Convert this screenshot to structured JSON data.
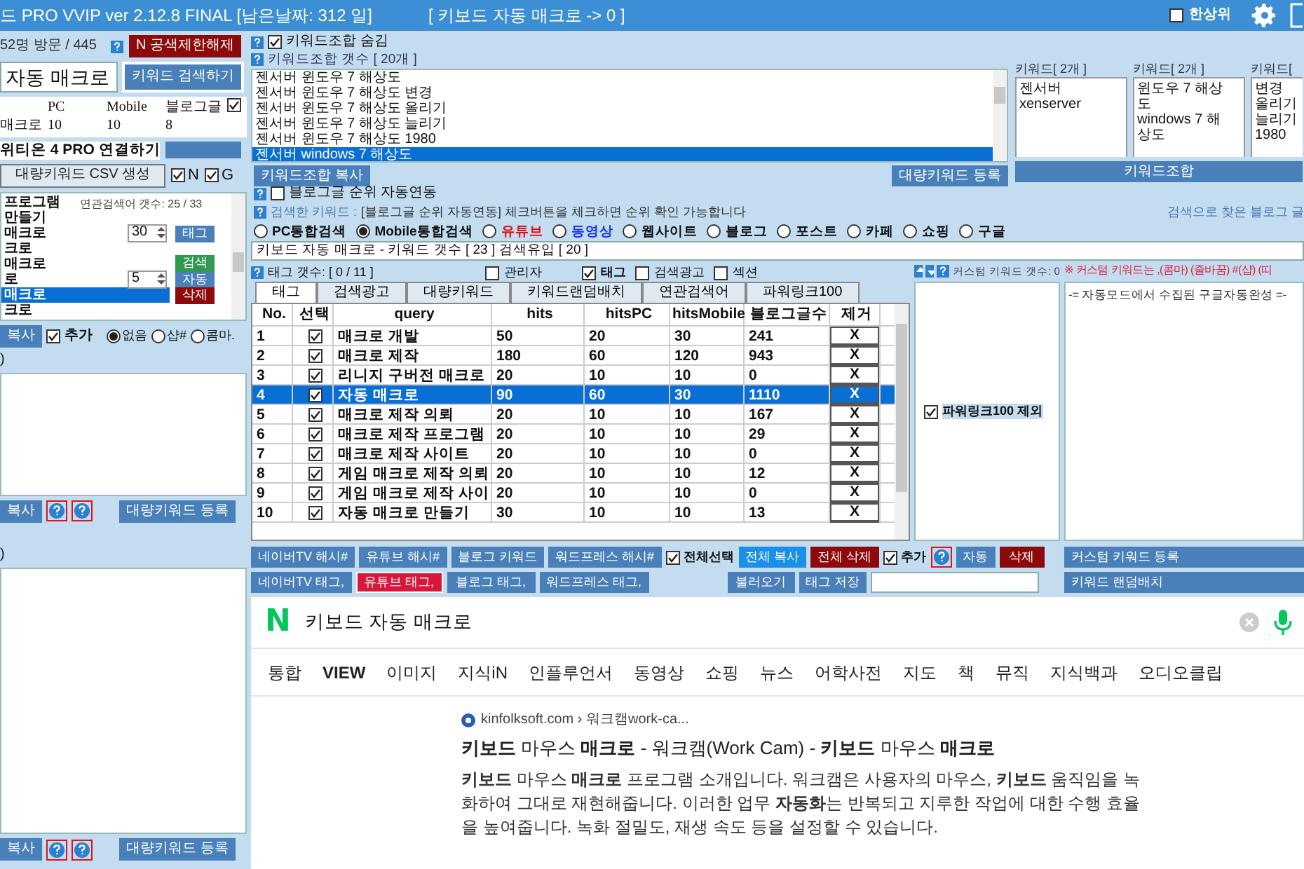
{
  "title_bar": {
    "title": "드 PRO VVIP ver 2.12.8 FINAL [남은날짜: 312 일]",
    "status": "[ 키보드 자동 매크로 -> 0 ]",
    "top_rank": {
      "label": "한상위",
      "checked": false
    }
  },
  "left_panel": {
    "visits": "52명 방문 / 445",
    "unlock_button": "N 공색제한해제",
    "search": {
      "value": "자동 매크로",
      "button": "키워드 검색하기"
    },
    "stats": {
      "columns": [
        "PC",
        "Mobile",
        "블로그글"
      ],
      "row": [
        "매크로",
        "10",
        "10",
        "8"
      ],
      "checked": true
    },
    "connect_label": "위티온 4 PRO 연결하기",
    "csv_button": "대량키워드 CSV 생성",
    "filters": [
      {
        "label": "N",
        "checked": true
      },
      {
        "label": "G",
        "checked": true
      }
    ],
    "related_count": "연관검색어 갯수: 25 / 33",
    "related": [
      {
        "text": "프로그램",
        "selected": false
      },
      {
        "text": "만들기",
        "selected": false
      },
      {
        "text": "매크로",
        "selected": false
      },
      {
        "text": "크로",
        "selected": false
      },
      {
        "text": "매크로",
        "selected": false
      },
      {
        "text": "로",
        "selected": false
      },
      {
        "text": "매크로",
        "selected": true
      },
      {
        "text": "크로",
        "selected": false
      }
    ],
    "spinners": [
      "30",
      "5"
    ],
    "side_buttons": [
      {
        "label": "태그",
        "kind": "blue"
      },
      {
        "label": "검색",
        "kind": "green"
      },
      {
        "label": "자동",
        "kind": "blue"
      },
      {
        "label": "삭제",
        "kind": "red"
      }
    ],
    "copy_button": "복사",
    "add": {
      "label": "추가",
      "checked": true
    },
    "separators": [
      {
        "label": "없음",
        "selected": true
      },
      {
        "label": "샵#",
        "selected": false
      },
      {
        "label": "콤마.",
        "selected": false
      }
    ],
    "boxes": [
      {
        "caption": ")",
        "copy": "복사",
        "register": "대량키워드 등록"
      },
      {
        "caption": ")",
        "copy": "복사",
        "register": "대량키워드 등록"
      }
    ]
  },
  "combo": {
    "hide": {
      "label": "키워드조합 숨김",
      "checked": true
    },
    "count": "키워드조합 갯수 [ 20개 ]",
    "items": [
      {
        "text": "젠서버 윈도우 7 해상도",
        "selected": false
      },
      {
        "text": "젠서버 윈도우 7 해상도 변경",
        "selected": false
      },
      {
        "text": "젠서버 윈도우 7 해상도 올리기",
        "selected": false
      },
      {
        "text": "젠서버 윈도우 7 해상도 늘리기",
        "selected": false
      },
      {
        "text": "젠서버 윈도우 7 해상도 1980",
        "selected": false
      },
      {
        "text": "젠서버 windows 7 해상도",
        "selected": true
      }
    ],
    "groups": [
      {
        "caption": "키워드[ 2개 ]",
        "items": [
          "젠서버",
          "xenserver"
        ]
      },
      {
        "caption": "키워드[ 2개 ]",
        "items": [
          "윈도우 7 해상도",
          "windows 7 해상도"
        ]
      },
      {
        "caption": "키워드[",
        "items": [
          "변경",
          "올리기",
          "늘리기",
          "1980"
        ]
      }
    ],
    "copy_button": "키워드조합 복사",
    "register_button": "대량키워드 등록",
    "combine_button": "키워드조합"
  },
  "rank": {
    "auto": {
      "label": "블로그글 순위 자동연동",
      "checked": false
    },
    "notice_label": "검색한 키워드 :",
    "notice": "[블로그글 순위 자동연동] 체크버튼을 체크하면 순위 확인 가능합니다",
    "found": "검색으로 찾은 블로그 글"
  },
  "search_types": [
    {
      "label": "PC통합검색",
      "selected": false,
      "color": "#111111"
    },
    {
      "label": "Mobile통합검색",
      "selected": true,
      "color": "#111111"
    },
    {
      "label": "유튜브",
      "selected": false,
      "color": "#e01010"
    },
    {
      "label": "동영상",
      "selected": false,
      "color": "#1a3be0"
    },
    {
      "label": "웹사이트",
      "selected": false,
      "color": "#111111"
    },
    {
      "label": "블로그",
      "selected": false,
      "color": "#111111"
    },
    {
      "label": "포스트",
      "selected": false,
      "color": "#111111"
    },
    {
      "label": "카페",
      "selected": false,
      "color": "#111111"
    },
    {
      "label": "쇼핑",
      "selected": false,
      "color": "#111111"
    },
    {
      "label": "구글",
      "selected": false,
      "color": "#111111"
    }
  ],
  "result_line": "키보드 자동 매크로 - 키워드 갯수 [ 23 ] 검색유입 [ 20 ]",
  "tags": {
    "count": "태그 갯수: [ 0 / 11 ]",
    "options": [
      {
        "label": "관리자",
        "checked": false
      },
      {
        "label": "태그",
        "checked": true
      },
      {
        "label": "검색광고",
        "checked": false
      },
      {
        "label": "섹션",
        "checked": false
      }
    ],
    "tabs": [
      {
        "label": "태그",
        "selected": true
      },
      {
        "label": "검색광고",
        "selected": false
      },
      {
        "label": "대량키워드",
        "selected": false
      },
      {
        "label": "키워드랜덤배치",
        "selected": false
      },
      {
        "label": "연관검색어",
        "selected": false
      },
      {
        "label": "파워링크100",
        "selected": false
      }
    ],
    "columns": [
      "No.",
      "선택",
      "query",
      "hits",
      "hitsPC",
      "hitsMobile",
      "블로그글수",
      "제거"
    ],
    "rows": [
      {
        "checked": true,
        "selected": false,
        "cells": [
          "1",
          "",
          "매크로 개발",
          "50",
          "20",
          "30",
          "241",
          "X"
        ]
      },
      {
        "checked": true,
        "selected": false,
        "cells": [
          "2",
          "",
          "매크로 제작",
          "180",
          "60",
          "120",
          "943",
          "X"
        ]
      },
      {
        "checked": true,
        "selected": false,
        "cells": [
          "3",
          "",
          "리니지 구버전 매크로",
          "20",
          "10",
          "10",
          "0",
          "X"
        ]
      },
      {
        "checked": true,
        "selected": true,
        "cells": [
          "4",
          "",
          "자동 매크로",
          "90",
          "60",
          "30",
          "1110",
          "X"
        ]
      },
      {
        "checked": true,
        "selected": false,
        "cells": [
          "5",
          "",
          "매크로 제작 의뢰",
          "20",
          "10",
          "10",
          "167",
          "X"
        ]
      },
      {
        "checked": true,
        "selected": false,
        "cells": [
          "6",
          "",
          "매크로 제작 프로그램",
          "20",
          "10",
          "10",
          "29",
          "X"
        ]
      },
      {
        "checked": true,
        "selected": false,
        "cells": [
          "7",
          "",
          "매크로 제작 사이트",
          "20",
          "10",
          "10",
          "0",
          "X"
        ]
      },
      {
        "checked": true,
        "selected": false,
        "cells": [
          "8",
          "",
          "게임 매크로 제작 의뢰",
          "20",
          "10",
          "10",
          "12",
          "X"
        ]
      },
      {
        "checked": true,
        "selected": false,
        "cells": [
          "9",
          "",
          "게임 매크로 제작 사이",
          "20",
          "10",
          "10",
          "0",
          "X"
        ]
      },
      {
        "checked": true,
        "selected": false,
        "cells": [
          "10",
          "",
          "자동 매크로 만들기",
          "30",
          "10",
          "10",
          "13",
          "X"
        ]
      }
    ],
    "buttons_top": [
      {
        "label": "네이버TV 해시#",
        "kind": "blue"
      },
      {
        "label": "유튜브 해시#",
        "kind": "blue"
      },
      {
        "label": "블로그 키워드",
        "kind": "blue"
      },
      {
        "label": "워드프레스 해시#",
        "kind": "blue"
      }
    ],
    "buttons_bottom": [
      {
        "label": "네이버TV 태그,",
        "kind": "blue"
      },
      {
        "label": "유튜브 태그,",
        "kind": "pink"
      },
      {
        "label": "블로그 태그,",
        "kind": "blue"
      },
      {
        "label": "워드프레스 태그,",
        "kind": "blue"
      }
    ],
    "select_all": {
      "label": "전체선택",
      "checked": true
    },
    "copy_all": "전체 복사",
    "delete_all": "전체 삭제",
    "add": {
      "label": "추가",
      "checked": true
    },
    "auto": "자동",
    "delete": "삭제",
    "load": "불러오기",
    "save": "태그 저장"
  },
  "custom": {
    "count": "커스텀 키워드 갯수: 0",
    "note": "※ 커스텀 키워드는 ,(콤마) (줄바꿈) #(샵) (띠",
    "exclude": {
      "label": "파워링크100 제외",
      "checked": true
    },
    "autocomplete": "-= 자동모드에서 수집된 구글자동완성 =-",
    "register_button": "커스텀 키워드 등록",
    "random_button": "키워드 랜덤배치"
  },
  "browser": {
    "logo": "N",
    "query": "키보드 자동 매크로",
    "tabs": [
      "통합",
      "VIEW",
      "이미지",
      "지식iN",
      "인플루언서",
      "동영상",
      "쇼핑",
      "뉴스",
      "어학사전",
      "지도",
      "책",
      "뮤직",
      "지식백과",
      "오디오클립"
    ],
    "result": {
      "breadcrumb": "kinfolksoft.com › 워크캠work-ca...",
      "title": "**키보드** 마우스 **매크로** - 워크캠(Work Cam) - **키보드** 마우스 **매크로**",
      "snippet": "**키보드** 마우스 **매크로** 프로그램 소개입니다. 워크캠은 사용자의 마우스, **키보드** 움직임을 녹화하여 그대로 재현해줍니다. 이러한 업무 **자동화**는 반복되고 지루한 작업에 대한 수행 효율을 높여줍니다. 녹화 절밀도, 재생 속도 등을 설정할 수 있습니다."
    }
  }
}
